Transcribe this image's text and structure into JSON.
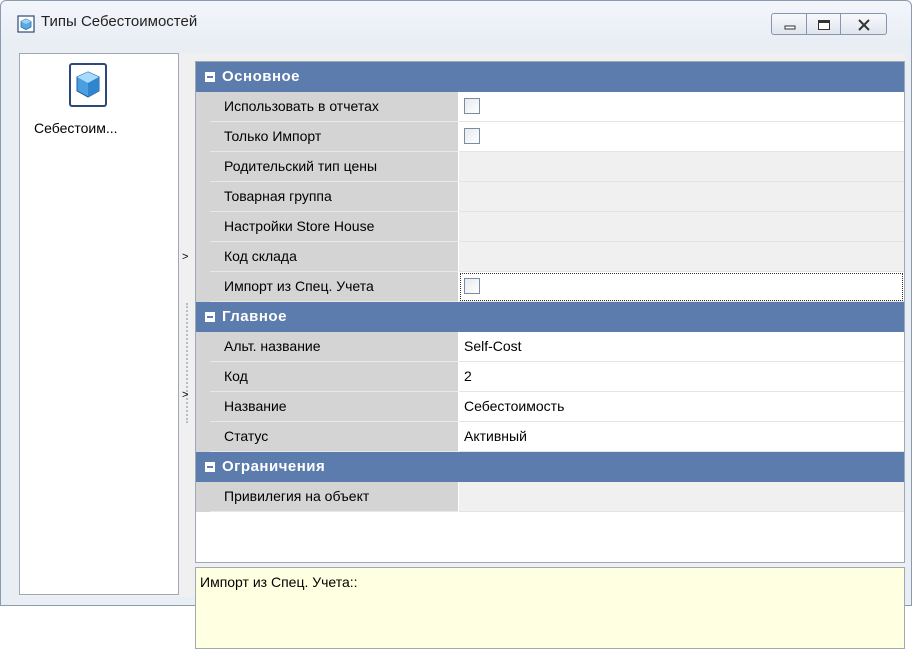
{
  "window": {
    "title": "Типы Себестоимостей",
    "icon": "cube-icon"
  },
  "left_pane": {
    "items": [
      {
        "label": "Себестоим...",
        "icon": "cube-icon"
      }
    ]
  },
  "property_grid": {
    "categories": [
      {
        "label": "Основное",
        "rows": [
          {
            "name": "Использовать в отчетах",
            "type": "checkbox",
            "checked": false
          },
          {
            "name": "Только Импорт",
            "type": "checkbox",
            "checked": false
          },
          {
            "name": "Родительский тип цены",
            "value": ""
          },
          {
            "name": "Товарная группа",
            "value": ""
          },
          {
            "name": "Настройки Store House",
            "value": ""
          },
          {
            "name": "Код склада",
            "value": ""
          },
          {
            "name": "Импорт из Спец. Учета",
            "type": "checkbox",
            "checked": false,
            "selected": true
          }
        ]
      },
      {
        "label": "Главное",
        "rows": [
          {
            "name": "Альт. название",
            "value": "Self-Cost"
          },
          {
            "name": "Код",
            "value": "2"
          },
          {
            "name": "Название",
            "value": "Себестоимость"
          },
          {
            "name": "Статус",
            "value": "Активный"
          }
        ]
      },
      {
        "label": "Ограничения",
        "rows": [
          {
            "name": "Привилегия на объект",
            "value": ""
          }
        ]
      }
    ]
  },
  "description": {
    "text": "Импорт из Спец. Учета::"
  },
  "colors": {
    "category_header": "#5b7cad",
    "name_column": "#d4d4d4",
    "description_bg": "#ffffe1"
  }
}
